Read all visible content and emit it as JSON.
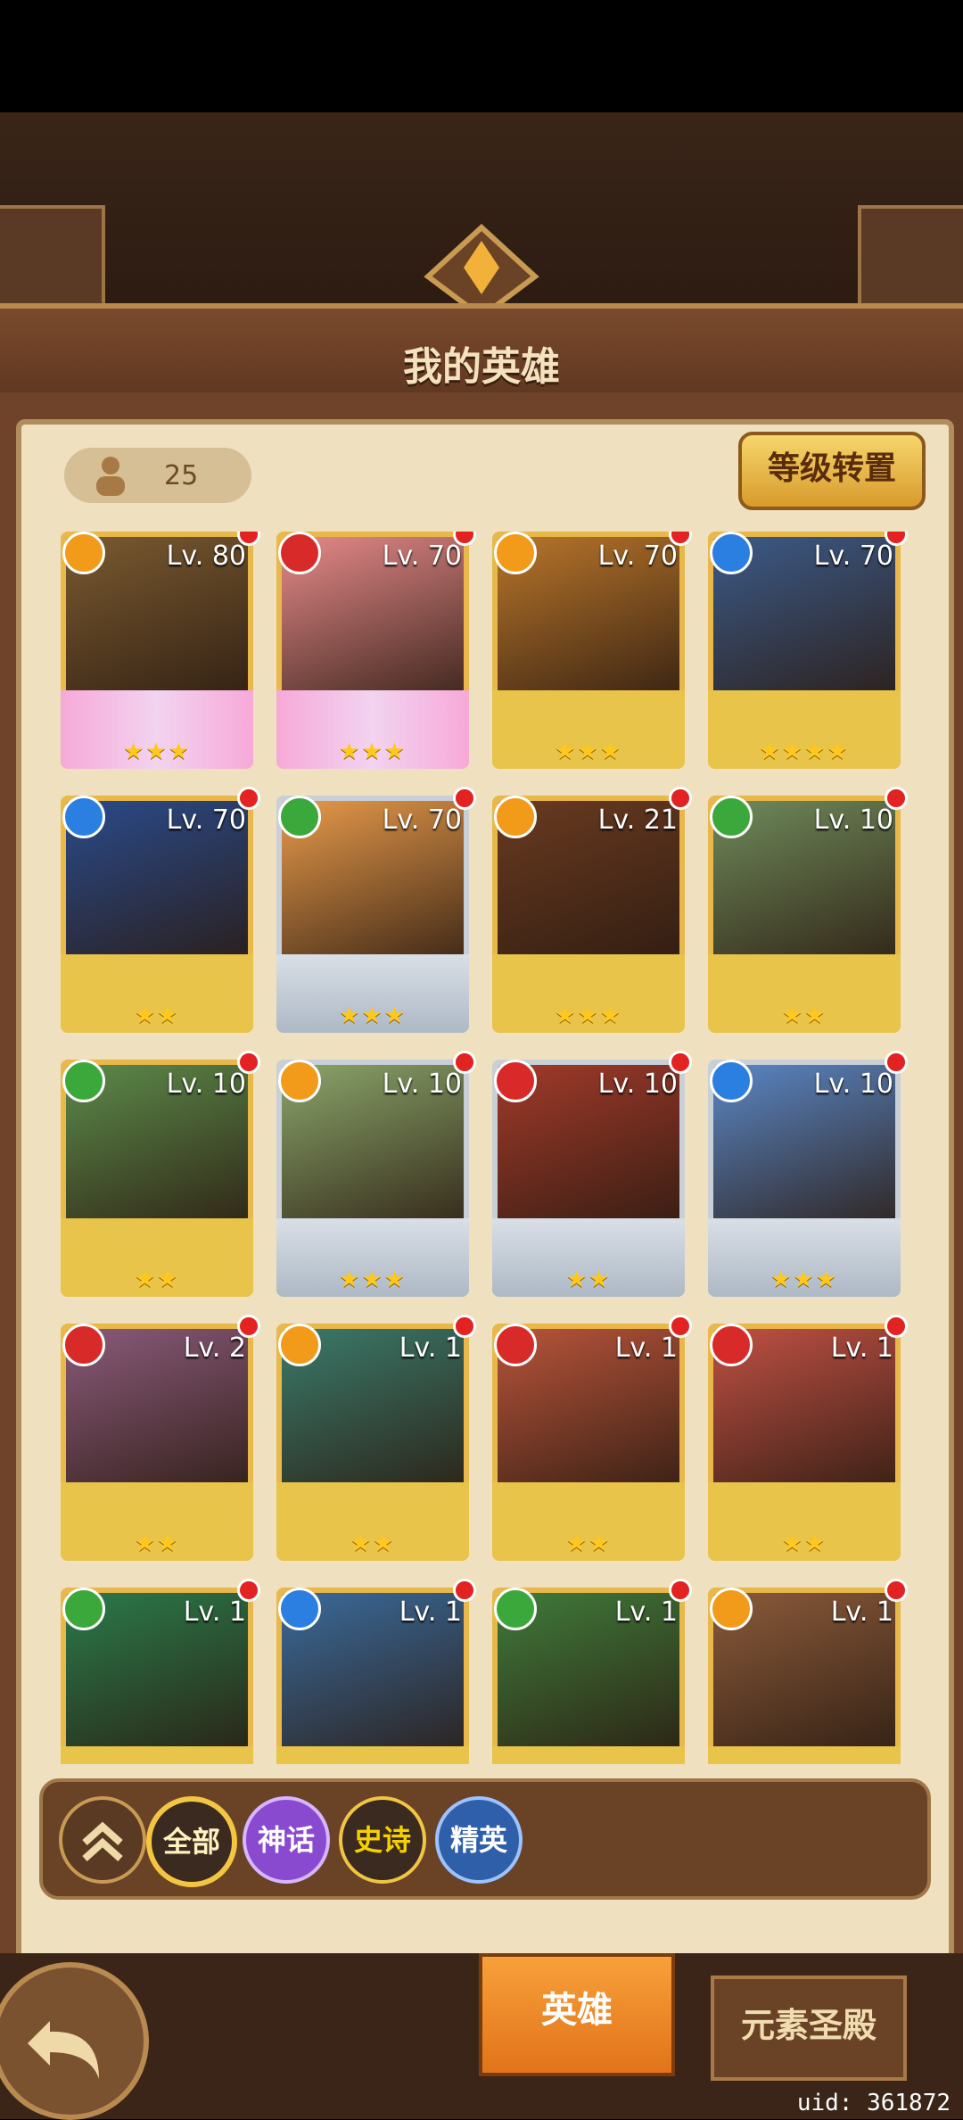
{
  "header": {
    "title": "我的英雄"
  },
  "counter": {
    "value": "25"
  },
  "level_transfer_button": "等级转置",
  "heroes": [
    {
      "level": "Lv. 80",
      "element": "fire-orange",
      "stars": "★★★",
      "frame": "mythic",
      "portrait": "#7a5a30"
    },
    {
      "level": "Lv. 70",
      "element": "fire-red",
      "stars": "★★★",
      "frame": "mythic",
      "portrait": "#e68a8a"
    },
    {
      "level": "Lv. 70",
      "element": "fire-orange",
      "stars": "★★★",
      "frame": "gold",
      "portrait": "#b8752a"
    },
    {
      "level": "Lv. 70",
      "element": "water",
      "stars": "★★★★",
      "frame": "gold",
      "portrait": "#3c5a88"
    },
    {
      "level": "Lv. 70",
      "element": "water",
      "stars": "★★",
      "frame": "gold",
      "portrait": "#2a4a8a"
    },
    {
      "level": "Lv. 70",
      "element": "nature",
      "stars": "★★★",
      "frame": "silver",
      "portrait": "#e79a4a"
    },
    {
      "level": "Lv. 21",
      "element": "fire-orange",
      "stars": "★★★",
      "frame": "gold",
      "portrait": "#6a3a20"
    },
    {
      "level": "Lv. 10",
      "element": "nature",
      "stars": "★★",
      "frame": "gold",
      "portrait": "#6f8a5a"
    },
    {
      "level": "Lv. 10",
      "element": "nature",
      "stars": "★★",
      "frame": "gold",
      "portrait": "#5c8a4a"
    },
    {
      "level": "Lv. 10",
      "element": "fire-orange",
      "stars": "★★★",
      "frame": "silver",
      "portrait": "#8aa56a"
    },
    {
      "level": "Lv. 10",
      "element": "fire-red",
      "stars": "★★",
      "frame": "silver",
      "portrait": "#a13a2a"
    },
    {
      "level": "Lv. 10",
      "element": "water",
      "stars": "★★★",
      "frame": "silver",
      "portrait": "#5a86c4"
    },
    {
      "level": "Lv. 2",
      "element": "fire-red",
      "stars": "★★",
      "frame": "gold",
      "portrait": "#8a5a7a"
    },
    {
      "level": "Lv. 1",
      "element": "fire-orange",
      "stars": "★★",
      "frame": "gold",
      "portrait": "#3a7a6a"
    },
    {
      "level": "Lv. 1",
      "element": "fire-red",
      "stars": "★★",
      "frame": "gold",
      "portrait": "#b8543a"
    },
    {
      "level": "Lv. 1",
      "element": "fire-red",
      "stars": "★★",
      "frame": "gold",
      "portrait": "#c05044"
    },
    {
      "level": "Lv. 1",
      "element": "nature",
      "stars": "",
      "frame": "gold",
      "portrait": "#2a7a4a"
    },
    {
      "level": "Lv. 1",
      "element": "water",
      "stars": "",
      "frame": "gold",
      "portrait": "#3a6a9a"
    },
    {
      "level": "Lv. 1",
      "element": "nature",
      "stars": "",
      "frame": "gold",
      "portrait": "#3f7a3a"
    },
    {
      "level": "Lv. 1",
      "element": "fire-orange",
      "stars": "",
      "frame": "gold",
      "portrait": "#8a5a3a"
    }
  ],
  "filters": {
    "all": "全部",
    "mythic": "神话",
    "epic": "史诗",
    "elite": "精英"
  },
  "tabs": {
    "heroes": "英雄",
    "shrine": "元素圣殿"
  },
  "uid": "uid: 361872",
  "colors": {
    "fire-orange": "#f29a1a",
    "fire-red": "#d92a2a",
    "water": "#2a7fe0",
    "nature": "#3aa83a"
  }
}
